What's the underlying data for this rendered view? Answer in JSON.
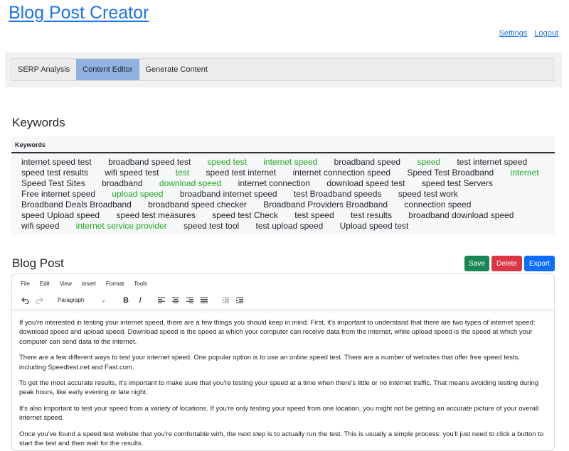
{
  "header": {
    "title": "Blog Post Creator",
    "links": {
      "settings": "Settings",
      "logout": "Logout"
    }
  },
  "tabs": [
    {
      "label": "SERP Analysis",
      "active": false
    },
    {
      "label": "Content Editor",
      "active": true
    },
    {
      "label": "Generate Content",
      "active": false
    }
  ],
  "keywords": {
    "title": "Keywords",
    "column_header": "Keywords",
    "highlight_color": "#1fa81f",
    "items": [
      {
        "text": "internet speed test",
        "hl": false
      },
      {
        "text": "broadband speed test",
        "hl": false
      },
      {
        "text": "speed test",
        "hl": true
      },
      {
        "text": "internet speed",
        "hl": true
      },
      {
        "text": "broadband speed",
        "hl": false
      },
      {
        "text": "speed",
        "hl": true
      },
      {
        "text": "test internet speed",
        "hl": false
      },
      {
        "text": "speed test results",
        "hl": false
      },
      {
        "text": "wifi speed test",
        "hl": false
      },
      {
        "text": "test",
        "hl": true
      },
      {
        "text": "speed test internet",
        "hl": false
      },
      {
        "text": "internet connection speed",
        "hl": false
      },
      {
        "text": "Speed Test Broadband",
        "hl": false
      },
      {
        "text": "internet",
        "hl": true
      },
      {
        "text": "Speed Test Sites",
        "hl": false
      },
      {
        "text": "broadband",
        "hl": false
      },
      {
        "text": "download speed",
        "hl": true
      },
      {
        "text": "internet connection",
        "hl": false
      },
      {
        "text": "download speed test",
        "hl": false
      },
      {
        "text": "speed test Servers",
        "hl": false
      },
      {
        "text": "Free internet speed",
        "hl": false
      },
      {
        "text": "upload speed",
        "hl": true
      },
      {
        "text": "broadband internet speed",
        "hl": false
      },
      {
        "text": "test Broadband speeds",
        "hl": false
      },
      {
        "text": "speed test work",
        "hl": false
      },
      {
        "text": "Broadband Deals Broadband",
        "hl": false
      },
      {
        "text": "broadband speed checker",
        "hl": false
      },
      {
        "text": "Broadband Providers Broadband",
        "hl": false
      },
      {
        "text": "connection speed",
        "hl": false
      },
      {
        "text": "speed Upload speed",
        "hl": false
      },
      {
        "text": "speed test measures",
        "hl": false
      },
      {
        "text": "speed test Check",
        "hl": false
      },
      {
        "text": "test speed",
        "hl": false
      },
      {
        "text": "test results",
        "hl": false
      },
      {
        "text": "broadband download speed",
        "hl": false
      },
      {
        "text": "wifi speed",
        "hl": false
      },
      {
        "text": "internet service provider",
        "hl": true
      },
      {
        "text": "speed test tool",
        "hl": false
      },
      {
        "text": "test upload speed",
        "hl": false
      },
      {
        "text": "Upload speed test",
        "hl": false
      }
    ]
  },
  "blog_post": {
    "title": "Blog Post",
    "buttons": {
      "save": "Save",
      "delete": "Delete",
      "export": "Export"
    },
    "button_colors": {
      "save": "#198754",
      "delete": "#dc3545",
      "export": "#0d6efd"
    },
    "editor": {
      "menu": [
        "File",
        "Edit",
        "View",
        "Insert",
        "Format",
        "Tools"
      ],
      "block_format": "Paragraph",
      "toolbar_icons": [
        "undo-icon",
        "redo-icon",
        "bold-icon",
        "italic-icon",
        "align-left-icon",
        "align-center-icon",
        "align-right-icon",
        "align-justify-icon",
        "outdent-icon",
        "indent-icon"
      ],
      "paragraphs": [
        "If you're interested in testing your internet speed, there are a few things you should keep in mind. First, it's important to understand that there are two types of internet speed: download speed and upload speed. Download speed is the speed at which your computer can receive data from the internet, while upload speed is the speed at which your computer can send data to the internet.",
        "There are a few different ways to test your internet speed. One popular option is to use an online speed test. There are a number of websites that offer free speed tests, including Speedtest.net and Fast.com.",
        "To get the most accurate results, it's important to make sure that you're testing your speed at a time when there's little or no internet traffic. That means avoiding testing during peak hours, like early evening or late night.",
        "It's also important to test your speed from a variety of locations. If you're only testing your speed from one location, you might not be getting an accurate picture of your overall internet speed.",
        "Once you've found a speed test website that you're comfortable with, the next step is to actually run the test. This is usually a simple process: you'll just need to click a button to start the test and then wait for the results."
      ]
    }
  }
}
